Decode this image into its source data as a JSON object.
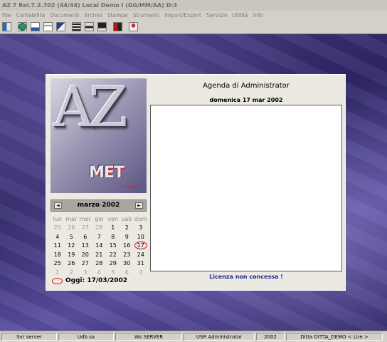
{
  "window": {
    "title": "AZ 7 Rel.7.2.702 (44/44) Local Demo I (GG/MM/AA) D:3"
  },
  "menu": [
    "File",
    "Contabilità",
    "Documenti",
    "Archivi",
    "Stampe",
    "Strumenti",
    "Import/Export",
    "Servizio",
    "Utilità",
    "Info"
  ],
  "toolbar": {
    "icons": [
      "exit-icon",
      "globe-icon",
      "document-icon",
      "folder-icon",
      "arrow-icon",
      "calculator-icon",
      "print-icon",
      "screen-icon",
      "book-icon",
      "user-icon"
    ]
  },
  "logo": {
    "letters": "AZ",
    "brand": "MET",
    "sub": "Calabria"
  },
  "calendar": {
    "month": "marzo 2002",
    "prev": "◄",
    "next": "►",
    "days_of_week": [
      "lun",
      "mar",
      "mer",
      "gio",
      "ven",
      "sab",
      "dom"
    ],
    "weeks": [
      [
        "25",
        "26",
        "27",
        "28",
        "1",
        "2",
        "3"
      ],
      [
        "4",
        "5",
        "6",
        "7",
        "8",
        "9",
        "10"
      ],
      [
        "11",
        "12",
        "13",
        "14",
        "15",
        "16",
        "17"
      ],
      [
        "18",
        "19",
        "20",
        "21",
        "22",
        "23",
        "24"
      ],
      [
        "25",
        "26",
        "27",
        "28",
        "29",
        "30",
        "31"
      ],
      [
        "1",
        "2",
        "3",
        "4",
        "5",
        "6",
        "7"
      ]
    ],
    "today_label": "Oggi: 17/03/2002"
  },
  "agenda": {
    "title": "Agenda di Administrator",
    "date": "domenica 17 mar 2002",
    "licence": "Licenza non concessa !"
  },
  "status": [
    "Svr server",
    "Udb sa",
    "Ws SERVER",
    "USR Administrator",
    "2002",
    "Ditta DITTA_DEMO  < Lire >"
  ],
  "colors": {
    "accent_red": "#cc1111",
    "licence_blue": "#1b2a8c",
    "desktop": "#3b3278"
  }
}
